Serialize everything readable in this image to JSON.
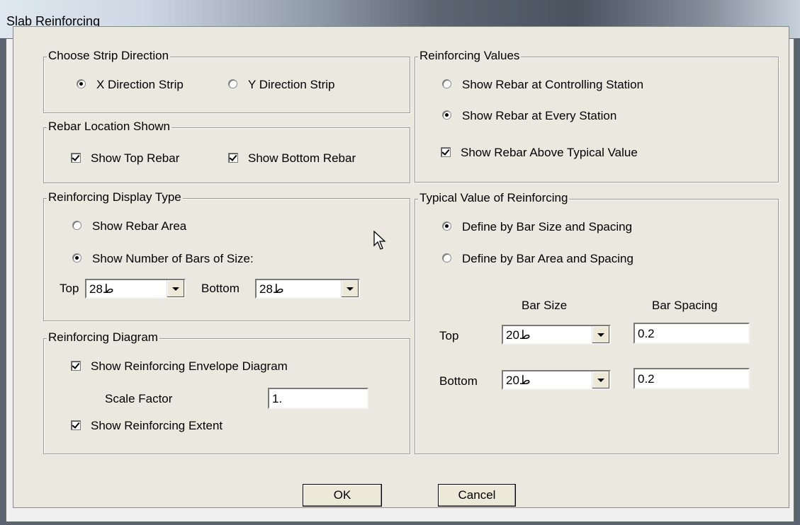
{
  "window": {
    "title": "Slab Reinforcing"
  },
  "strip_direction": {
    "legend": "Choose Strip Direction",
    "options": [
      {
        "label": "X Direction Strip",
        "selected": true
      },
      {
        "label": "Y Direction Strip",
        "selected": false
      }
    ]
  },
  "rebar_location": {
    "legend": "Rebar Location Shown",
    "show_top": {
      "label": "Show Top Rebar",
      "checked": true
    },
    "show_bottom": {
      "label": "Show Bottom Rebar",
      "checked": true
    }
  },
  "display_type": {
    "legend": "Reinforcing Display Type",
    "area": {
      "label": "Show Rebar Area",
      "selected": false
    },
    "number": {
      "label": "Show Number of Bars of Size:",
      "selected": true
    },
    "top_label": "Top",
    "top_value": "ط28",
    "bottom_label": "Bottom",
    "bottom_value": "ط28"
  },
  "diagram": {
    "legend": "Reinforcing Diagram",
    "envelope": {
      "label": "Show Reinforcing Envelope Diagram",
      "checked": true
    },
    "scale_label": "Scale Factor",
    "scale_value": "1.",
    "extent": {
      "label": "Show Reinforcing Extent",
      "checked": true
    }
  },
  "values": {
    "legend": "Reinforcing Values",
    "controlling": {
      "label": "Show Rebar at Controlling Station",
      "selected": false
    },
    "every": {
      "label": "Show Rebar at Every Station",
      "selected": true
    },
    "above": {
      "label": "Show Rebar Above Typical Value",
      "checked": true
    }
  },
  "typical": {
    "legend": "Typical Value of Reinforcing",
    "size_spacing": {
      "label": "Define by Bar Size and Spacing",
      "selected": true
    },
    "area_spacing": {
      "label": "Define by Bar Area and Spacing",
      "selected": false
    },
    "col_size": "Bar Size",
    "col_spacing": "Bar Spacing",
    "top_label": "Top",
    "top_size": "ط20",
    "top_spacing": "0.2",
    "bottom_label": "Bottom",
    "bottom_size": "ط20",
    "bottom_spacing": "0.2"
  },
  "buttons": {
    "ok": "OK",
    "cancel": "Cancel"
  }
}
